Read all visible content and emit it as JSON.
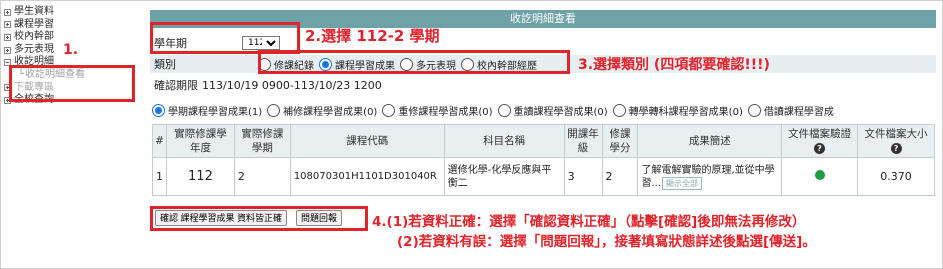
{
  "sidebar": {
    "items": [
      {
        "label": "學生資料",
        "state": "plus"
      },
      {
        "label": "課程學習",
        "state": "plus"
      },
      {
        "label": "校內幹部",
        "state": "plus"
      },
      {
        "label": "多元表現",
        "state": "plus"
      },
      {
        "label": "收訖明細",
        "state": "minus"
      },
      {
        "label": "收訖明細查看",
        "state": "sub"
      },
      {
        "label": "下載專區",
        "state": "plus"
      },
      {
        "label": "全校查詢",
        "state": "plus"
      }
    ]
  },
  "panel": {
    "title": "收訖明細查看",
    "semester_label": "學年期",
    "semester_value": "112-2",
    "category_label": "類別",
    "categories": [
      "修課紀錄",
      "課程學習成果",
      "多元表現",
      "校內幹部經歷"
    ],
    "category_selected": 1,
    "period_label": "確認期限",
    "period_value": "113/10/19 0900-113/10/23 1200",
    "subtypes": [
      "學期課程學習成果(1)",
      "補修課程學習成果(0)",
      "重修課程學習成果(0)",
      "重讀課程學習成果(0)",
      "轉學轉科課程學習成果(0)",
      "借讀課程學習成"
    ],
    "subtype_selected": 0
  },
  "table": {
    "headers": [
      "#",
      "實際修課學年度",
      "實際修課學期",
      "課程代碼",
      "科目名稱",
      "開課年級",
      "修課學分",
      "成果簡述",
      "文件檔案驗證",
      "文件檔案大小"
    ],
    "rows": [
      {
        "no": "1",
        "year": "112",
        "semester": "2",
        "code": "108070301H1101D301040R",
        "subject": "選修化學-化學反應與平衡二",
        "grade": "3",
        "credit": "2",
        "summary": "了解電解實驗的原理,並從中學習...",
        "summary_btn": "顯示全部",
        "verified_color": "#1f9d40",
        "size": "0.370"
      }
    ]
  },
  "buttons": {
    "confirm": "確認 課程學習成果 資料皆正確",
    "report": "問題回報"
  },
  "annotations": {
    "a1": "1.",
    "a2": "2.選擇 112-2 學期",
    "a3": "3.選擇類別 (四項都要確認!!!)",
    "a4_line1": "4.(1)若資料正確：選擇「確認資料正確」（點擊[確認]後即無法再修改）",
    "a4_line2": "(2)若資料有誤：選擇「問題回報」，接著填寫狀態詳述後點選[傳送]。"
  },
  "colors": {
    "accent_red": "#e0242b",
    "titlebar": "#6ea1a8",
    "radio_on": "#1a73e8"
  }
}
